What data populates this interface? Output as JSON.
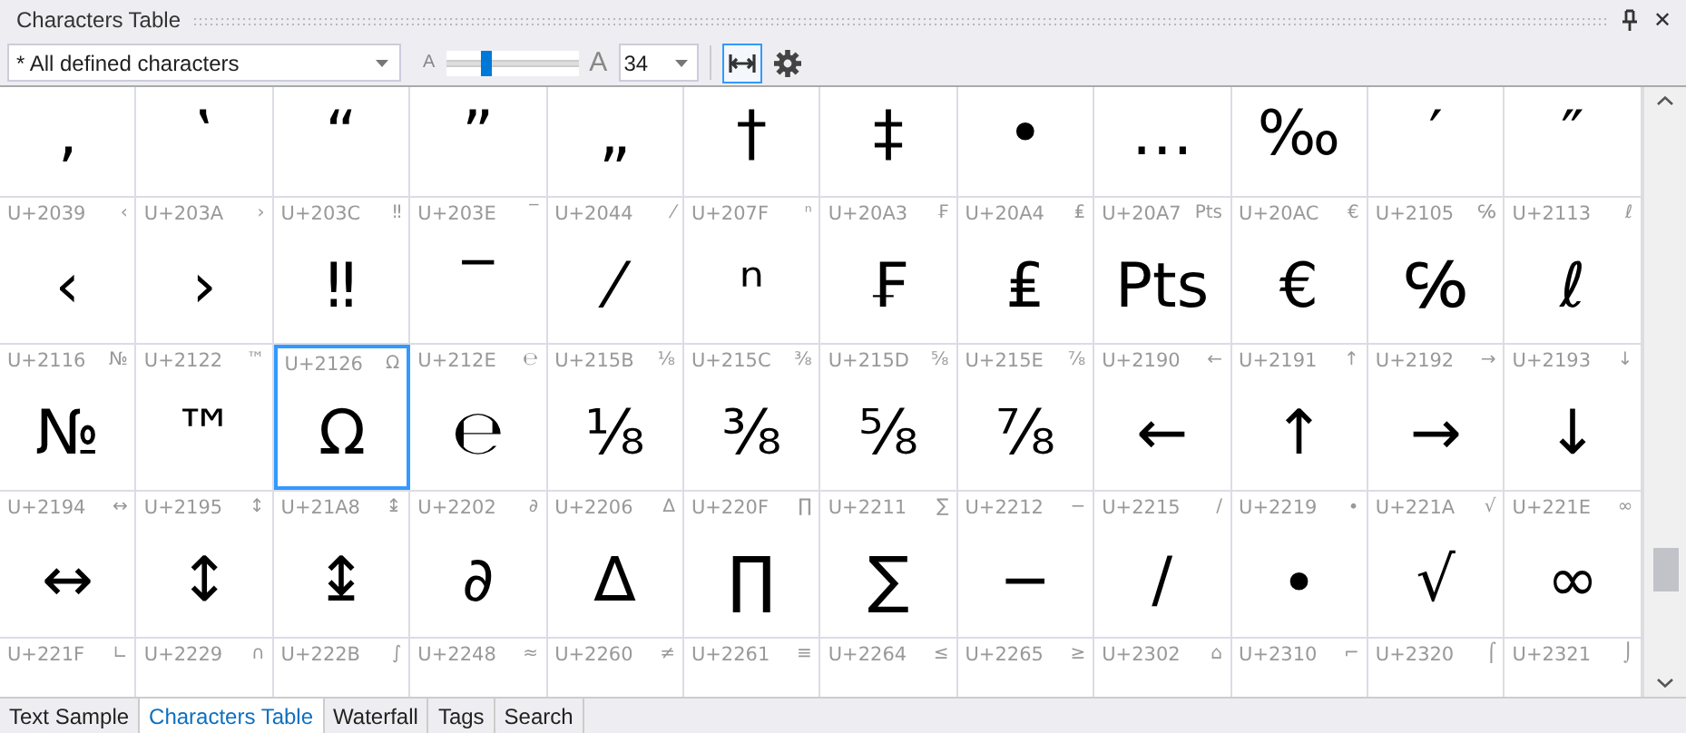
{
  "panel": {
    "title": "Characters Table",
    "close": "✕"
  },
  "toolbar": {
    "filter": "* All defined characters",
    "size_small_label": "A",
    "size_slider": {
      "level": 0.27
    },
    "size_large_label": "A",
    "font_size": "34",
    "fit_width": {
      "on": true
    }
  },
  "top_row": [
    {
      "char": "‚"
    },
    {
      "char": "‛"
    },
    {
      "char": "“"
    },
    {
      "char": "”"
    },
    {
      "char": "„"
    },
    {
      "char": "†"
    },
    {
      "char": "‡"
    },
    {
      "char": "•"
    },
    {
      "char": "…"
    },
    {
      "char": "‰"
    },
    {
      "char": "′"
    },
    {
      "char": "″"
    }
  ],
  "rows": [
    {
      "cells": [
        {
          "code": "U+2039",
          "mini": "‹",
          "char": "‹",
          "selected": false
        },
        {
          "code": "U+203A",
          "mini": "›",
          "char": "›",
          "selected": false
        },
        {
          "code": "U+203C",
          "mini": "‼",
          "char": "‼",
          "selected": false
        },
        {
          "code": "U+203E",
          "mini": "‾",
          "char": "‾",
          "selected": false
        },
        {
          "code": "U+2044",
          "mini": "⁄",
          "char": "⁄",
          "selected": false
        },
        {
          "code": "U+207F",
          "mini": "ⁿ",
          "char": "ⁿ",
          "selected": false
        },
        {
          "code": "U+20A3",
          "mini": "₣",
          "char": "₣",
          "selected": false
        },
        {
          "code": "U+20A4",
          "mini": "₤",
          "char": "₤",
          "selected": false
        },
        {
          "code": "U+20A7",
          "mini": "Pts",
          "char": "Pts",
          "selected": false
        },
        {
          "code": "U+20AC",
          "mini": "€",
          "char": "€",
          "selected": false
        },
        {
          "code": "U+2105",
          "mini": "℅",
          "char": "℅",
          "selected": false
        },
        {
          "code": "U+2113",
          "mini": "ℓ",
          "char": "ℓ",
          "selected": false
        }
      ]
    },
    {
      "cells": [
        {
          "code": "U+2116",
          "mini": "№",
          "char": "№",
          "selected": false
        },
        {
          "code": "U+2122",
          "mini": "™",
          "char": "™",
          "selected": false
        },
        {
          "code": "U+2126",
          "mini": "Ω",
          "char": "Ω",
          "selected": true
        },
        {
          "code": "U+212E",
          "mini": "℮",
          "char": "℮",
          "selected": false
        },
        {
          "code": "U+215B",
          "mini": "⅛",
          "char": "⅛",
          "selected": false
        },
        {
          "code": "U+215C",
          "mini": "⅜",
          "char": "⅜",
          "selected": false
        },
        {
          "code": "U+215D",
          "mini": "⅝",
          "char": "⅝",
          "selected": false
        },
        {
          "code": "U+215E",
          "mini": "⅞",
          "char": "⅞",
          "selected": false
        },
        {
          "code": "U+2190",
          "mini": "←",
          "char": "←",
          "selected": false
        },
        {
          "code": "U+2191",
          "mini": "↑",
          "char": "↑",
          "selected": false
        },
        {
          "code": "U+2192",
          "mini": "→",
          "char": "→",
          "selected": false
        },
        {
          "code": "U+2193",
          "mini": "↓",
          "char": "↓",
          "selected": false
        }
      ]
    },
    {
      "cells": [
        {
          "code": "U+2194",
          "mini": "↔",
          "char": "↔",
          "selected": false
        },
        {
          "code": "U+2195",
          "mini": "↕",
          "char": "↕",
          "selected": false
        },
        {
          "code": "U+21A8",
          "mini": "↨",
          "char": "↨",
          "selected": false
        },
        {
          "code": "U+2202",
          "mini": "∂",
          "char": "∂",
          "selected": false
        },
        {
          "code": "U+2206",
          "mini": "∆",
          "char": "∆",
          "selected": false
        },
        {
          "code": "U+220F",
          "mini": "∏",
          "char": "∏",
          "selected": false
        },
        {
          "code": "U+2211",
          "mini": "∑",
          "char": "∑",
          "selected": false
        },
        {
          "code": "U+2212",
          "mini": "−",
          "char": "−",
          "selected": false
        },
        {
          "code": "U+2215",
          "mini": "∕",
          "char": "∕",
          "selected": false
        },
        {
          "code": "U+2219",
          "mini": "∙",
          "char": "∙",
          "selected": false
        },
        {
          "code": "U+221A",
          "mini": "√",
          "char": "√",
          "selected": false
        },
        {
          "code": "U+221E",
          "mini": "∞",
          "char": "∞",
          "selected": false
        }
      ]
    },
    {
      "cells": [
        {
          "code": "U+221F",
          "mini": "∟",
          "selected": false
        },
        {
          "code": "U+2229",
          "mini": "∩",
          "selected": false
        },
        {
          "code": "U+222B",
          "mini": "∫",
          "selected": false
        },
        {
          "code": "U+2248",
          "mini": "≈",
          "selected": false
        },
        {
          "code": "U+2260",
          "mini": "≠",
          "selected": false
        },
        {
          "code": "U+2261",
          "mini": "≡",
          "selected": false
        },
        {
          "code": "U+2264",
          "mini": "≤",
          "selected": false
        },
        {
          "code": "U+2265",
          "mini": "≥",
          "selected": false
        },
        {
          "code": "U+2302",
          "mini": "⌂",
          "selected": false
        },
        {
          "code": "U+2310",
          "mini": "⌐",
          "selected": false
        },
        {
          "code": "U+2320",
          "mini": "⌠",
          "selected": false
        },
        {
          "code": "U+2321",
          "mini": "⌡",
          "selected": false
        }
      ]
    }
  ],
  "tabs": [
    {
      "label": "Text Sample",
      "selected": false
    },
    {
      "label": "Characters Table",
      "selected": true
    },
    {
      "label": "Waterfall",
      "selected": false
    },
    {
      "label": "Tags",
      "selected": false
    },
    {
      "label": "Search",
      "selected": false
    }
  ]
}
